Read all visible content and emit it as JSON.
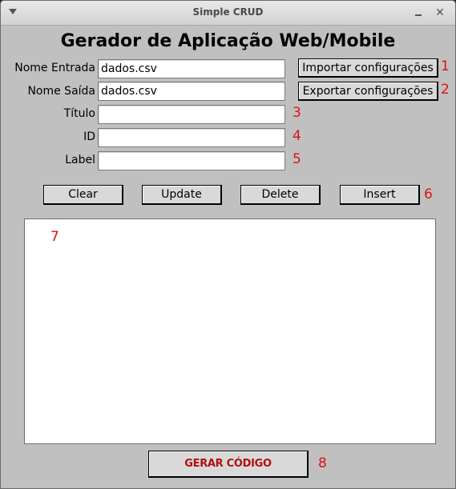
{
  "window": {
    "title": "Simple CRUD",
    "menu_icon": "triangle-down-icon",
    "minimize_icon": "minimize-icon",
    "close_icon": "close-icon",
    "close_glyph": "✕"
  },
  "header": {
    "title": "Gerador de Aplicação Web/Mobile"
  },
  "form": {
    "nome_entrada": {
      "label": "Nome Entrada",
      "value": "dados.csv"
    },
    "nome_saida": {
      "label": "Nome Saída",
      "value": "dados.csv"
    },
    "titulo": {
      "label": "Título",
      "value": ""
    },
    "id": {
      "label": "ID",
      "value": ""
    },
    "label": {
      "label": "Label",
      "value": ""
    }
  },
  "config_buttons": {
    "importar": "Importar configurações",
    "exportar": "Exportar configurações"
  },
  "actions": {
    "clear": "Clear",
    "update": "Update",
    "delete": "Delete",
    "insert": "Insert"
  },
  "generate": {
    "label": "GERAR CÓDIGO"
  },
  "annotations": {
    "n1": "1",
    "n2": "2",
    "n3": "3",
    "n4": "4",
    "n5": "5",
    "n6": "6",
    "n7": "7",
    "n8": "8"
  },
  "colors": {
    "window_bg": "#c0c0c0",
    "annotation": "#e01010",
    "generate_text": "#b01010"
  }
}
